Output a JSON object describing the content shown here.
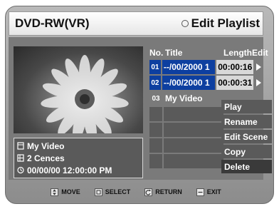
{
  "header": {
    "app_title": "DVD-RW(VR)",
    "screen_title": "Edit Playlist"
  },
  "info": {
    "title": "My Video",
    "scenes": "2 Cences",
    "datetime": "00/00/00 12:00:00  PM"
  },
  "list": {
    "headers": {
      "no": "No.",
      "title": "Title",
      "length": "Length",
      "edit": "Edit"
    },
    "rows": [
      {
        "no": "01",
        "title": "--/00/2000 1",
        "length": "00:00:16"
      },
      {
        "no": "02",
        "title": "--/00/2000 1",
        "length": "00:00:31"
      },
      {
        "no": "03",
        "title": "My Video",
        "length": ""
      }
    ]
  },
  "menu": {
    "items": [
      "Play",
      "Rename",
      "Edit Scene",
      "Copy",
      "Delete"
    ],
    "highlighted": "Delete"
  },
  "hints": {
    "move": "MOVE",
    "select": "SELECT",
    "return": "RETURN",
    "exit": "EXIT"
  },
  "colors": {
    "accent_blue": "#0d3fa0",
    "panel_gray": "#7a7a7a",
    "cell_gray": "#5a5a5a"
  }
}
